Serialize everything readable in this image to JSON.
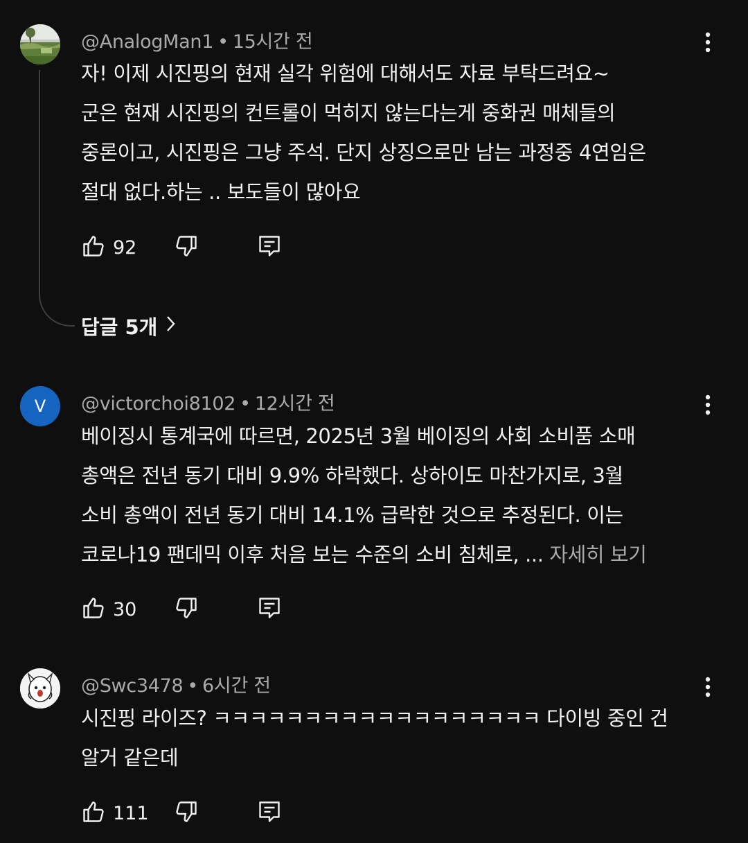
{
  "comments": [
    {
      "author": "@AnalogMan1",
      "separator": "•",
      "time": "15시간 전",
      "lines": [
        "자! 이제 시진핑의 현재 실각 위험에 대해서도 자료 부탁드려요~",
        "군은 현재 시진핑의 컨트롤이 먹히지 않는다는게 중화권 매체들의",
        "중론이고, 시진핑은 그냥 주석. 단지 상징으로만 남는 과정중 4연임은",
        "절대 없다.하는 .. 보도들이 많아요"
      ],
      "likes": "92",
      "replies_label": "답글 5개"
    },
    {
      "author": "@victorchoi8102",
      "separator": "•",
      "time": "12시간 전",
      "avatar_letter": "V",
      "lines": [
        "베이징시 통계국에 따르면, 2025년 3월 베이징의 사회 소비품 소매",
        "총액은 전년 동기 대비 9.9% 하락했다. 상하이도 마찬가지로, 3월",
        "소비 총액이 전년 동기 대비 14.1% 급락한 것으로 추정된다. 이는",
        "코로나19 팬데믹 이후 처음 보는 수준의 소비 침체로, ..."
      ],
      "more_label": "자세히 보기",
      "likes": "30"
    },
    {
      "author": "@Swc3478",
      "separator": "•",
      "time": "6시간 전",
      "lines": [
        "시진핑 라이즈? ㅋㅋㅋㅋㅋㅋㅋㅋㅋㅋㅋㅋㅋㅋㅋㅋㅋㅋ 다이빙 중인 건",
        "알거 같은데"
      ],
      "likes": "111"
    }
  ],
  "colors": {
    "background": "#0f0f0f",
    "text": "#f1f1f1",
    "secondary_text": "#aaaaaa",
    "avatar_v": "#1565c0",
    "thread_line": "#3f3f3f"
  },
  "icons": {
    "like": "thumbs-up-icon",
    "dislike": "thumbs-down-icon",
    "reply": "comment-reply-icon",
    "more": "vertical-ellipsis-icon",
    "expand": "chevron-right-icon"
  }
}
